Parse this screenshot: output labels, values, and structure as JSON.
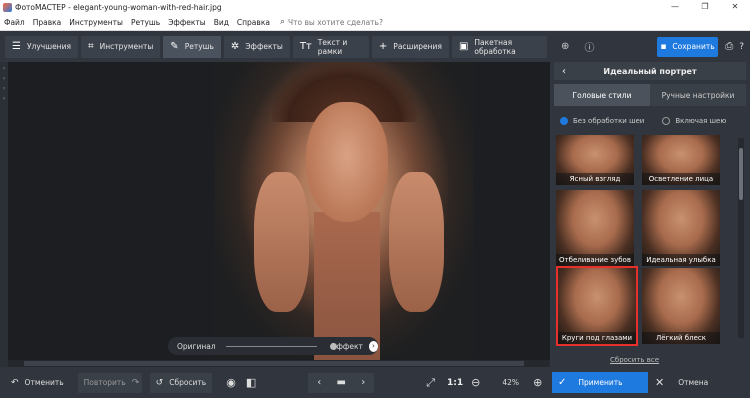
{
  "window": {
    "title": "ФотоМАСТЕР - elegant-young-woman-with-red-hair.jpg",
    "controls": [
      "—",
      "❐",
      "✕"
    ]
  },
  "menu": {
    "items": [
      "Файл",
      "Правка",
      "Инструменты",
      "Ретушь",
      "Эффекты",
      "Вид",
      "Справка"
    ],
    "search_placeholder": "Что вы хотите сделать?"
  },
  "toolbar": {
    "tabs": [
      {
        "label": "Улучшения",
        "icon": "sliders-icon"
      },
      {
        "label": "Инструменты",
        "icon": "crop-icon"
      },
      {
        "label": "Ретушь",
        "icon": "brush-icon",
        "active": true
      },
      {
        "label": "Эффекты",
        "icon": "magic-wand-icon"
      },
      {
        "label": "Текст и рамки",
        "icon": "text-icon"
      },
      {
        "label": "Расширения",
        "icon": "plus-icon"
      },
      {
        "label": "Пакетная обработка",
        "icon": "image-stack-icon"
      }
    ]
  },
  "right_panel": {
    "save_label": "Сохранить",
    "panel_title": "Идеальный портрет",
    "tabs": [
      "Головые стили",
      "Ручные настройки"
    ],
    "radio_options": [
      "Без обработки шеи",
      "Включая шею"
    ],
    "presets": [
      "Ясный взгляд",
      "Осветление лица",
      "Отбеливание зубов",
      "Идеальная улыбка",
      "Круги под глазами",
      "Лёгкий блеск"
    ],
    "selected_preset": "Круги под глазами",
    "reset_all": "Сбросить все"
  },
  "canvas": {
    "compare_original": "Оригинал",
    "compare_effect": "Эффект"
  },
  "bottom": {
    "undo": "Отменить",
    "redo": "Повторить",
    "reset": "Сбросить",
    "ratio": "1:1",
    "zoom": "42%",
    "apply": "Применить",
    "cancel": "Отмена"
  },
  "colors": {
    "accent": "#1f7ae0",
    "selection": "#e5302b",
    "panel": "#31363e"
  }
}
